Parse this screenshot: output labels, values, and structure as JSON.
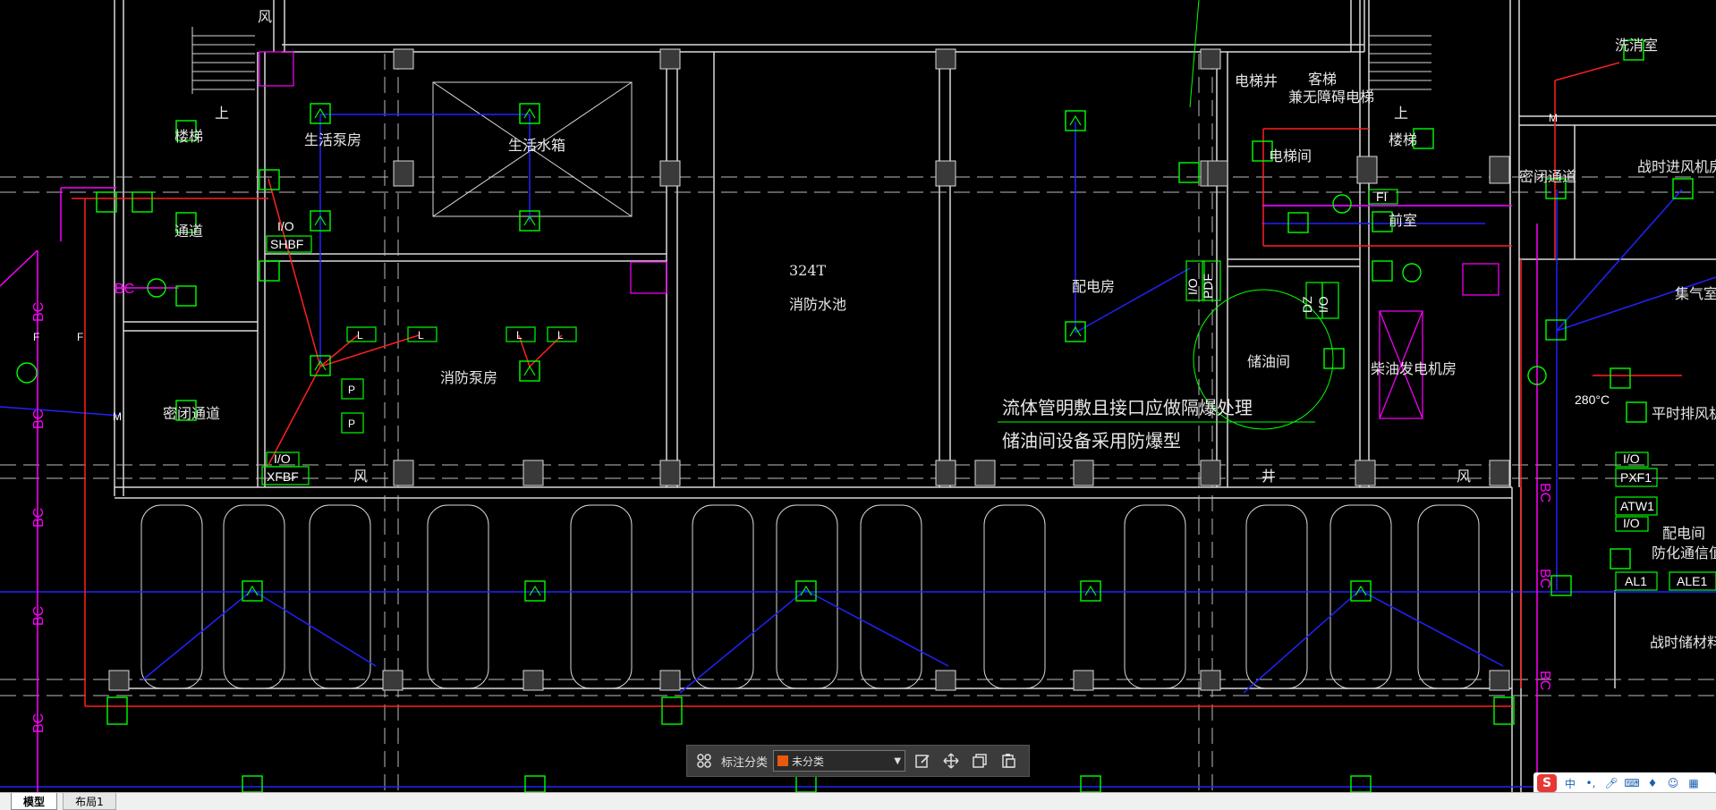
{
  "rooms": {
    "life_pump_room": "生活泵房",
    "life_water_tank": "生活水箱",
    "fire_pool_capacity": "324T",
    "fire_pool": "消防水池",
    "fire_pump_room": "消防泵房",
    "distribution_room": "配电房",
    "oil_storage": "储油间",
    "diesel_generator_room": "柴油发电机房",
    "elevator_shaft": "电梯井",
    "elevator_room": "电梯间",
    "closed_passage_left": "密闭通道",
    "closed_passage_right": "密闭通道",
    "wartime_inlet_fan_room": "战时进风机房",
    "decon_room": "洗消室",
    "gas_collection_room": "集气室",
    "wartime_exhaust_fan_room": "平时排风机房",
    "distribution_room_right": "配电间",
    "protective_comm_room": "防化通信值班",
    "wartime_material_room": "战时储材料",
    "stair_left": "楼梯",
    "stair_right": "楼梯",
    "corridor_left": "通道",
    "pre_room": "前室",
    "wind_left": "风",
    "wind_bottom": "风",
    "wind_bottom_right": "风",
    "up_left": "上",
    "up_right": "上",
    "shaft_bottom": "井",
    "guest_elevator": "客梯",
    "accessible_elevator": "兼无障碍电梯"
  },
  "notes": {
    "line1": "流体管明敷且接口应做隔爆处理",
    "line2": "储油间设备采用防爆型"
  },
  "equipment_tags": {
    "shbf": "SHBF",
    "xfbf": "XFBF",
    "pdf": "PDF",
    "pxf1": "PXF1",
    "atw1": "ATW1",
    "al1": "AL1",
    "ale1": "ALE1",
    "fi": "FI",
    "io": "I/O",
    "dz": "DZ",
    "temp_280": "280°C"
  },
  "symbols": {
    "bc": "BC",
    "l": "L",
    "p": "P",
    "f": "F",
    "m": "M"
  },
  "toolbar": {
    "category_label": "标注分类",
    "category_value": "未分类",
    "category_color": "#e8590c"
  },
  "tabs": {
    "model": "模型",
    "layout1": "布局1"
  },
  "ime": {
    "logo": "S",
    "mode": "中"
  },
  "colors": {
    "wall": "#d9d9d9",
    "equipment": "#00ff00",
    "blue_line": "#2222ff",
    "red_line": "#ff2020",
    "magenta": "#ff00ff",
    "background": "#000000"
  }
}
